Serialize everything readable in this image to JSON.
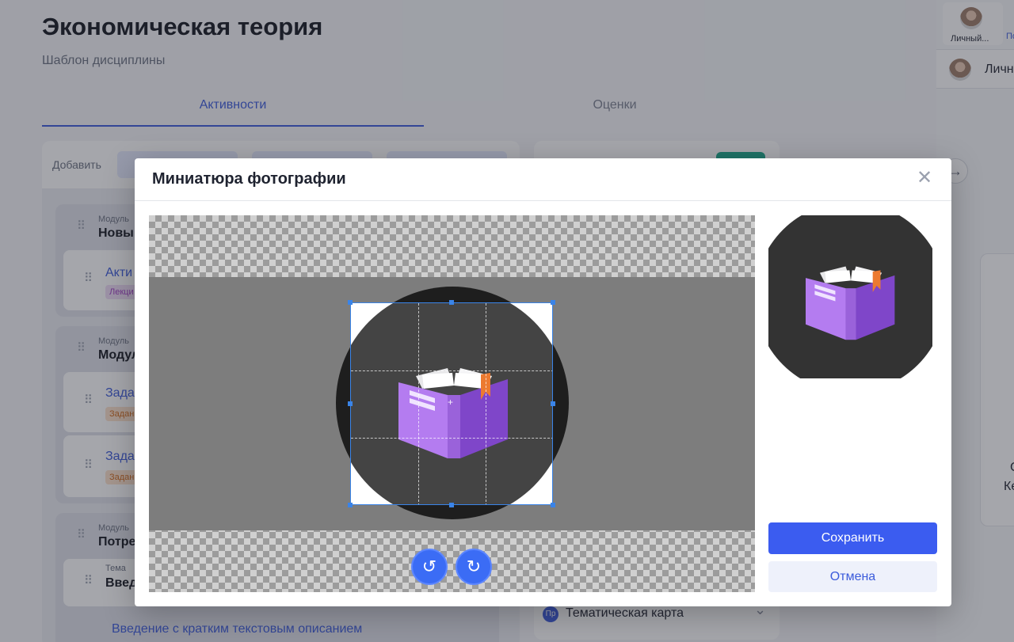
{
  "page": {
    "title": "Экономическая теория",
    "subtitle": "Шаблон дисциплины",
    "tabs": [
      {
        "label": "Активности"
      },
      {
        "label": "Оценки"
      }
    ],
    "add_label": "Добавить"
  },
  "modules": [
    {
      "caption": "Модуль",
      "name": "Новый",
      "items": [
        {
          "name": "Акти",
          "tag": "Лекци"
        }
      ]
    },
    {
      "caption": "Модуль",
      "name": "Модул",
      "items": [
        {
          "name": "Зада",
          "tag": "Задан"
        },
        {
          "name": "Зада",
          "tag": "Задан"
        }
      ]
    },
    {
      "caption": "Модуль",
      "name": "Потре",
      "items": [
        {
          "caption": "Тема",
          "name": "Введ"
        }
      ]
    }
  ],
  "intro_link": "Введение с кратким текстовым описанием",
  "thematic_map": {
    "badge": "Пр",
    "label": "Тематическая карта"
  },
  "sidebar": {
    "tab_personal": "Личный...",
    "tab_second": "По",
    "row_label": "Личн",
    "fragment_1": "С",
    "fragment_2": "Ке"
  },
  "modal": {
    "title": "Миниатюра фотографии",
    "save_label": "Сохранить",
    "cancel_label": "Отмена"
  },
  "colors": {
    "accent": "#3b5bdb",
    "save_button": "#3b5cf0",
    "book_purple": "#a86ee8",
    "bookmark": "#e9732b"
  },
  "icons": {
    "close": "close-icon",
    "rotate_left": "rotate-left-icon",
    "rotate_right": "rotate-right-icon",
    "book": "book-icon"
  }
}
